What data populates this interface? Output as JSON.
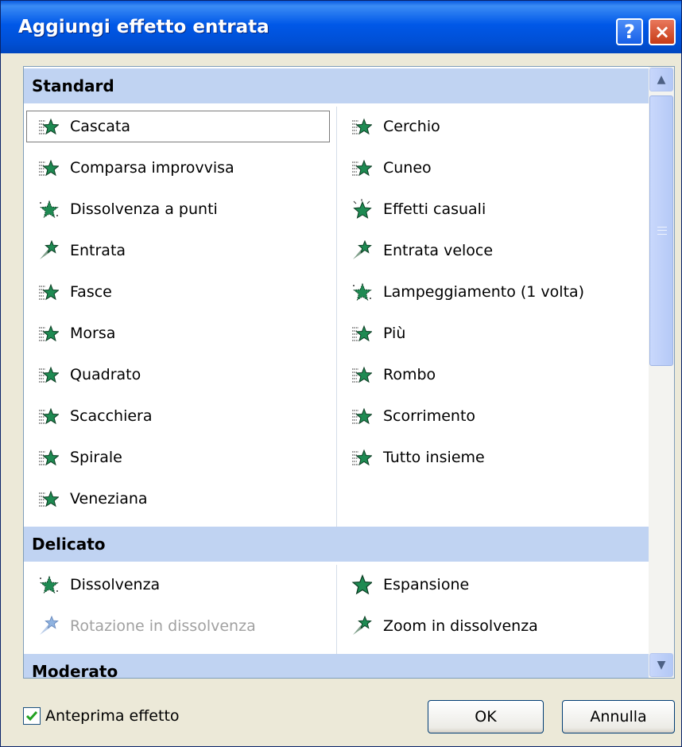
{
  "dialog": {
    "title": "Aggiungi effetto entrata",
    "help_symbol": "?",
    "close_symbol": "×"
  },
  "sections": [
    {
      "name": "Standard",
      "left": [
        {
          "label": "Cascata",
          "icon": "star-effect-icon",
          "selected": true
        },
        {
          "label": "Comparsa improvvisa",
          "icon": "star-effect-icon"
        },
        {
          "label": "Dissolvenza a punti",
          "icon": "star-dissolve-icon"
        },
        {
          "label": "Entrata",
          "icon": "star-fly-in-icon"
        },
        {
          "label": "Fasce",
          "icon": "star-effect-icon"
        },
        {
          "label": "Morsa",
          "icon": "star-effect-icon"
        },
        {
          "label": "Quadrato",
          "icon": "star-effect-icon"
        },
        {
          "label": "Scacchiera",
          "icon": "star-effect-icon"
        },
        {
          "label": "Spirale",
          "icon": "star-effect-icon"
        },
        {
          "label": "Veneziana",
          "icon": "star-effect-icon"
        }
      ],
      "right": [
        {
          "label": "Cerchio",
          "icon": "star-effect-icon"
        },
        {
          "label": "Cuneo",
          "icon": "star-effect-icon"
        },
        {
          "label": "Effetti casuali",
          "icon": "star-random-icon"
        },
        {
          "label": "Entrata veloce",
          "icon": "star-fly-in-icon"
        },
        {
          "label": "Lampeggiamento (1 volta)",
          "icon": "star-flash-icon"
        },
        {
          "label": "Più",
          "icon": "star-effect-icon"
        },
        {
          "label": "Rombo",
          "icon": "star-effect-icon"
        },
        {
          "label": "Scorrimento",
          "icon": "star-effect-icon"
        },
        {
          "label": "Tutto insieme",
          "icon": "star-effect-icon"
        }
      ]
    },
    {
      "name": "Delicato",
      "left": [
        {
          "label": "Dissolvenza",
          "icon": "star-flash-icon"
        },
        {
          "label": "Rotazione in dissolvenza",
          "icon": "star-fly-in-icon",
          "disabled": true
        }
      ],
      "right": [
        {
          "label": "Espansione",
          "icon": "star-expand-icon"
        },
        {
          "label": "Zoom in dissolvenza",
          "icon": "star-fly-in-icon"
        }
      ]
    },
    {
      "name": "Moderato",
      "left": [],
      "right": []
    }
  ],
  "footer": {
    "preview_label": "Anteprima effetto",
    "preview_checked": true,
    "ok_label": "OK",
    "cancel_label": "Annulla"
  },
  "colors": {
    "star_green": "#1e8a52",
    "section_header": "#c0d3f2",
    "title_bar": "#0058e8"
  }
}
